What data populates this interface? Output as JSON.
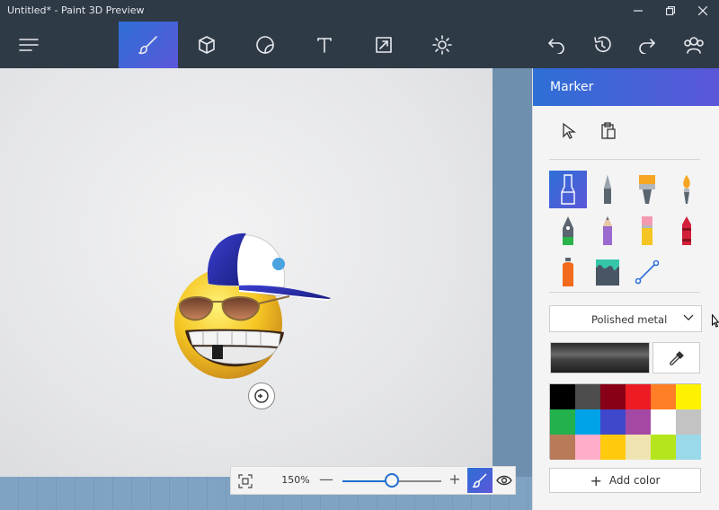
{
  "window": {
    "title": "Untitled* - Paint 3D Preview"
  },
  "toolbar": {
    "icons": [
      "menu-icon",
      "brush-icon",
      "cube-icon",
      "sticker-icon",
      "text-icon",
      "canvas-icon",
      "effects-icon",
      "undo-icon",
      "history-icon",
      "redo-icon",
      "community-icon"
    ]
  },
  "zoom": {
    "percent_label": "150%",
    "minus": "—",
    "plus": "+",
    "level": 0.5
  },
  "panel": {
    "title": "Marker",
    "texture": "Polished metal",
    "add_color_plus": "+",
    "add_color_label": "Add color",
    "selected_tool": "marker",
    "tools": [
      "marker",
      "calligraphy-pen",
      "oil-brush",
      "watercolor",
      "pixel-pen",
      "pencil",
      "eraser",
      "crayon",
      "spray-can",
      "fill",
      "line"
    ],
    "palette": [
      "#000000",
      "#4d4d4d",
      "#880015",
      "#ed1c24",
      "#ff7f27",
      "#fff200",
      "#22b14c",
      "#00a2e8",
      "#3f48cc",
      "#a349a4",
      "#ffffff",
      "#c3c3c3",
      "#b97a57",
      "#ffaec9",
      "#ffc90e",
      "#efe4b0",
      "#b5e61d",
      "#99d9ea"
    ]
  },
  "colors": {
    "accent": "#2e6fd6",
    "toolbar_bg": "#2f3a47"
  }
}
